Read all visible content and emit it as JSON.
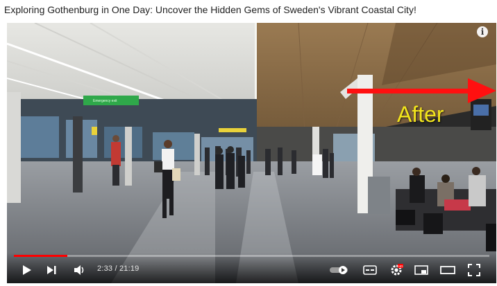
{
  "page": {
    "title": "Exploring Gothenburg in One Day: Uncover the Hidden Gems of Sweden's Vibrant Coastal City!"
  },
  "video": {
    "overlay_text": "After",
    "sign_text": "Emergency exit",
    "info_icon": "i",
    "progress": 0.113,
    "time_display": "2:33 / 21:19",
    "accent_color": "#ff0000",
    "overlay_color": "#f2e51c"
  },
  "controls": {
    "play": "play-icon",
    "next": "next-icon",
    "volume": "volume-icon",
    "autoplay": "autoplay-toggle-icon",
    "subtitles": "subtitles-icon",
    "settings": "gear-icon",
    "settings_badge": "HD",
    "miniplayer": "miniplayer-icon",
    "theater": "theater-icon",
    "fullscreen": "fullscreen-icon"
  }
}
